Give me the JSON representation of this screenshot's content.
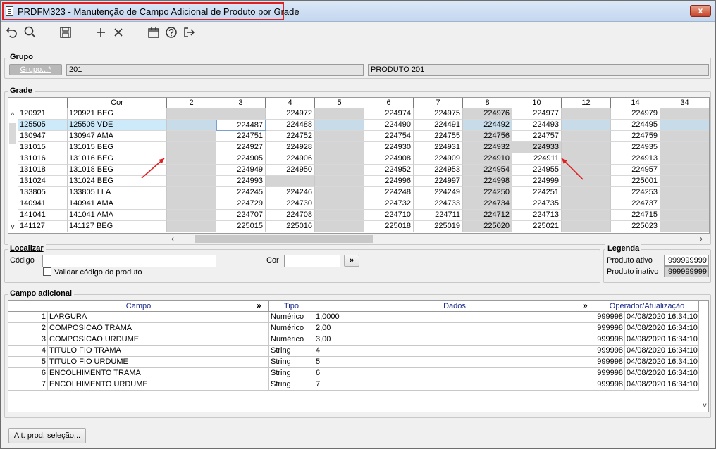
{
  "window": {
    "title": "PRDFM323 - Manutenção de Campo Adicional de Produto por Grade",
    "close_label": "x"
  },
  "toolbar": {
    "icons": [
      "undo-icon",
      "search-icon",
      "save-icon",
      "add-icon",
      "delete-icon",
      "calendar-icon",
      "help-icon",
      "exit-icon"
    ]
  },
  "grupo": {
    "legend": "Grupo",
    "button_label": "Grupo...*",
    "code": "201",
    "description": "PRODUTO 201"
  },
  "grade": {
    "legend": "Grade",
    "columns": [
      "",
      "Cor",
      "2",
      "3",
      "4",
      "5",
      "6",
      "7",
      "8",
      "10",
      "12",
      "14",
      "34"
    ],
    "rows": [
      [
        "120921",
        "120921 BEG",
        "",
        "",
        "224972",
        "",
        "224974",
        "224975",
        "224976",
        "224977",
        "",
        "224979",
        ""
      ],
      [
        "125505",
        "125505 VDE",
        "",
        "224487",
        "224488",
        "",
        "224490",
        "224491",
        "224492",
        "224493",
        "",
        "224495",
        ""
      ],
      [
        "130947",
        "130947 AMA",
        "",
        "224751",
        "224752",
        "",
        "224754",
        "224755",
        "224756",
        "224757",
        "",
        "224759",
        ""
      ],
      [
        "131015",
        "131015 BEG",
        "",
        "224927",
        "224928",
        "",
        "224930",
        "224931",
        "224932",
        "224933",
        "",
        "224935",
        ""
      ],
      [
        "131016",
        "131016 BEG",
        "",
        "224905",
        "224906",
        "",
        "224908",
        "224909",
        "224910",
        "224911",
        "",
        "224913",
        ""
      ],
      [
        "131018",
        "131018 BEG",
        "",
        "224949",
        "224950",
        "",
        "224952",
        "224953",
        "224954",
        "224955",
        "",
        "224957",
        ""
      ],
      [
        "131024",
        "131024 BEG",
        "",
        "224993",
        "",
        "",
        "224996",
        "224997",
        "224998",
        "224999",
        "",
        "225001",
        ""
      ],
      [
        "133805",
        "133805 LLA",
        "",
        "224245",
        "224246",
        "",
        "224248",
        "224249",
        "224250",
        "224251",
        "",
        "224253",
        ""
      ],
      [
        "140941",
        "140941 AMA",
        "",
        "224729",
        "224730",
        "",
        "224732",
        "224733",
        "224734",
        "224735",
        "",
        "224737",
        ""
      ],
      [
        "141041",
        "141041 AMA",
        "",
        "224707",
        "224708",
        "",
        "224710",
        "224711",
        "224712",
        "224713",
        "",
        "224715",
        ""
      ],
      [
        "141127",
        "141127 BEG",
        "",
        "225015",
        "225016",
        "",
        "225018",
        "225019",
        "225020",
        "225021",
        "",
        "225023",
        ""
      ]
    ]
  },
  "localizar": {
    "legend": "Localizar",
    "codigo_label": "Código",
    "codigo_value": "",
    "validar_label": "Validar código do produto",
    "validar_checked": false,
    "cor_label": "Cor",
    "cor_value": "",
    "go_label": "»"
  },
  "legenda": {
    "legend": "Legenda",
    "ativo_label": "Produto ativo",
    "ativo_value": "999999999",
    "inativo_label": "Produto inativo",
    "inativo_value": "999999999"
  },
  "campo_adicional": {
    "legend": "Campo adicional",
    "columns": [
      "Campo",
      "Tipo",
      "Dados",
      "Operador/Atualização"
    ],
    "expand_label": "»",
    "rows": [
      [
        "1",
        "LARGURA",
        "Numérico",
        "1,0000",
        "999998",
        "04/08/2020 16:34:10"
      ],
      [
        "2",
        "COMPOSICAO TRAMA",
        "Numérico",
        "2,00",
        "999998",
        "04/08/2020 16:34:10"
      ],
      [
        "3",
        "COMPOSICAO URDUME",
        "Numérico",
        "3,00",
        "999998",
        "04/08/2020 16:34:10"
      ],
      [
        "4",
        "TITULO FIO TRAMA",
        "String",
        "4",
        "999998",
        "04/08/2020 16:34:10"
      ],
      [
        "5",
        "TITULO FIO URDUME",
        "String",
        "5",
        "999998",
        "04/08/2020 16:34:10"
      ],
      [
        "6",
        "ENCOLHIMENTO TRAMA",
        "String",
        "6",
        "999998",
        "04/08/2020 16:34:10"
      ],
      [
        "7",
        "ENCOLHIMENTO URDUME",
        "String",
        "7",
        "999998",
        "04/08/2020 16:34:10"
      ]
    ]
  },
  "footer": {
    "alt_button_label": "Alt. prod. seleção..."
  }
}
